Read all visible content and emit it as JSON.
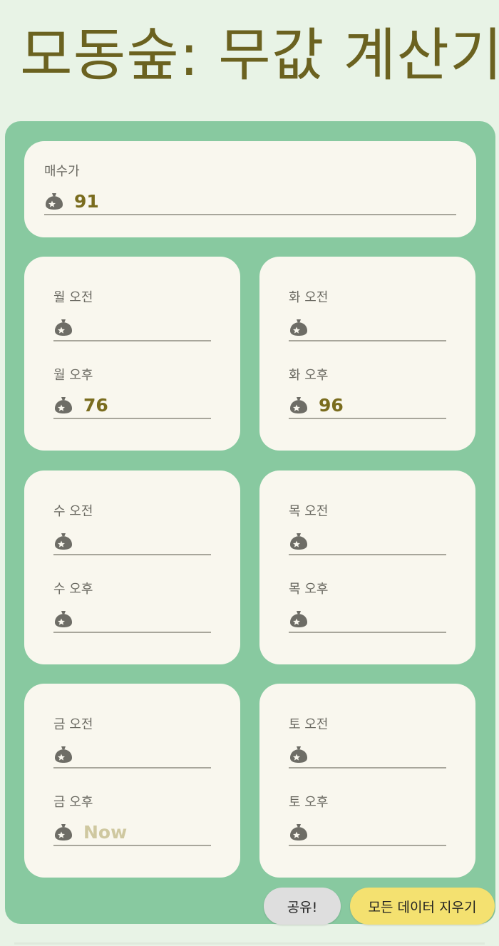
{
  "header": {
    "title": "모동숲: 무값 계산기"
  },
  "purchase": {
    "label": "매수가",
    "value": "91"
  },
  "days": [
    {
      "am": {
        "label": "월 오전",
        "value": ""
      },
      "pm": {
        "label": "월 오후",
        "value": "76"
      }
    },
    {
      "am": {
        "label": "화 오전",
        "value": ""
      },
      "pm": {
        "label": "화 오후",
        "value": "96"
      }
    },
    {
      "am": {
        "label": "수 오전",
        "value": ""
      },
      "pm": {
        "label": "수 오후",
        "value": ""
      }
    },
    {
      "am": {
        "label": "목 오전",
        "value": ""
      },
      "pm": {
        "label": "목 오후",
        "value": ""
      }
    },
    {
      "am": {
        "label": "금 오전",
        "value": ""
      },
      "pm": {
        "label": "금 오후",
        "value": "",
        "placeholder": "Now"
      }
    },
    {
      "am": {
        "label": "토 오전",
        "value": ""
      },
      "pm": {
        "label": "토 오후",
        "value": ""
      }
    }
  ],
  "actions": {
    "share_label": "공유!",
    "clear_label": "모든 데이터 지우기"
  },
  "icons": {
    "field_icon": "bell-bag-icon"
  },
  "colors": {
    "title": "#6b6220",
    "panel": "#88c9a0",
    "card": "#f9f7ee",
    "value": "#7a6c1e",
    "share_button": "#dedede",
    "clear_button": "#f4e170"
  }
}
